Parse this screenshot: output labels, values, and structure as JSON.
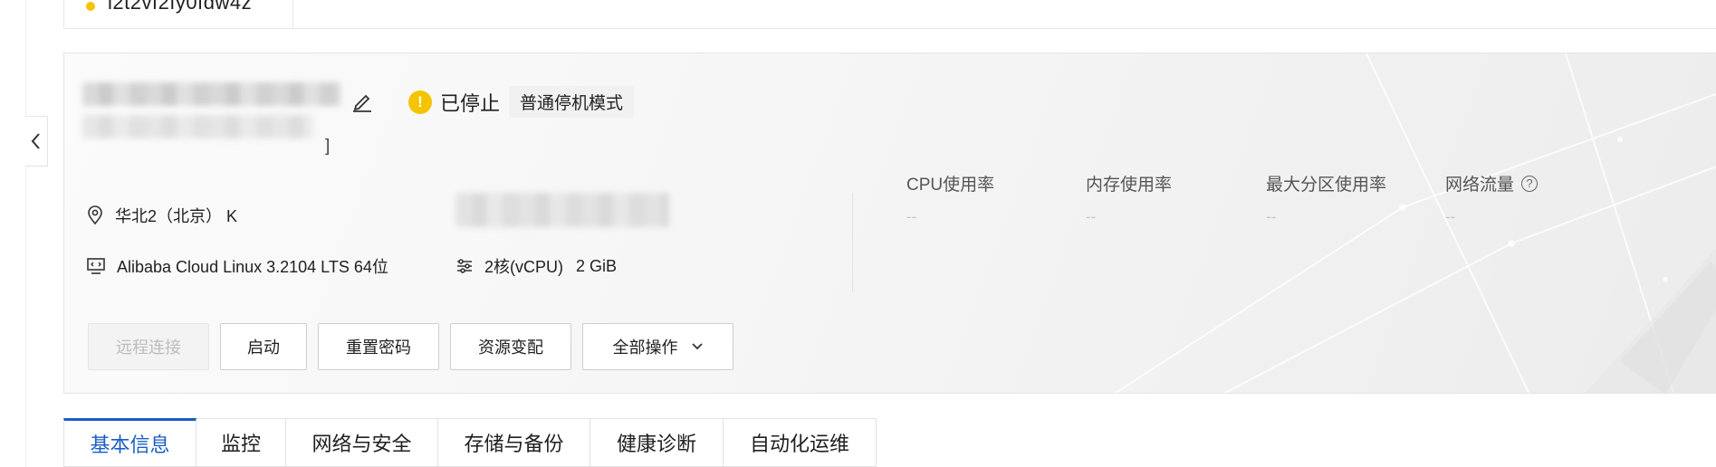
{
  "instance_tab": {
    "label": "i2t2vf2fy0fdw4z"
  },
  "instance": {
    "name_suffix": "]",
    "status": "已停止",
    "stop_mode": "普通停机模式"
  },
  "info": {
    "region": "华北2（北京） K",
    "os": "Alibaba Cloud Linux 3.2104 LTS 64位",
    "cpu": "2核(vCPU)",
    "memory": "2 GiB"
  },
  "metrics": [
    {
      "label": "CPU使用率",
      "value": "--"
    },
    {
      "label": "内存使用率",
      "value": "--"
    },
    {
      "label": "最大分区使用率",
      "value": "--"
    },
    {
      "label": "网络流量",
      "value": "--"
    }
  ],
  "actions": {
    "remote": "远程连接",
    "start": "启动",
    "reset_password": "重置密码",
    "resize": "资源变配",
    "all_actions": "全部操作"
  },
  "tabs": [
    {
      "label": "基本信息",
      "active": true
    },
    {
      "label": "监控"
    },
    {
      "label": "网络与安全"
    },
    {
      "label": "存储与备份"
    },
    {
      "label": "健康诊断"
    },
    {
      "label": "自动化运维"
    }
  ],
  "colors": {
    "accent": "#1a5ec4",
    "warning": "#f5c400"
  },
  "icons": [
    "chevron-left-icon",
    "edit-icon",
    "warning-icon",
    "location-pin-icon",
    "monitor-code-icon",
    "sliders-icon",
    "help-icon",
    "chevron-down-icon"
  ]
}
